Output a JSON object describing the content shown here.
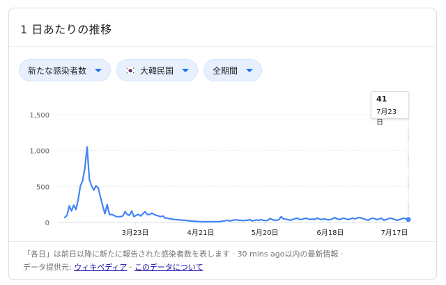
{
  "card": {
    "title": "1 日あたりの推移"
  },
  "filters": {
    "metric": "新たな感染者数",
    "country": "大韓民国",
    "range": "全期間"
  },
  "tooltip": {
    "value": "41",
    "date": "7月23日"
  },
  "footer": {
    "line1_note": "「各日」は前日以降に新たに報告された感染者数を表します",
    "line1_sep": " · ",
    "line1_update": "30 mins ago以内の最新情報",
    "line1_end": " ·",
    "source_label": "データ提供元: ",
    "source_link": "ウィキペディア",
    "about_sep": " · ",
    "about_link": "このデータについて"
  },
  "colors": {
    "line": "#4285f4",
    "grid": "#dadce0",
    "chip_bg": "#e8f0fe"
  },
  "chart_data": {
    "type": "line",
    "ylim": [
      0,
      1500
    ],
    "yticks": [
      0,
      500,
      1000,
      1500
    ],
    "ytick_labels": [
      "0",
      "500",
      "1,000",
      "1,500"
    ],
    "xtick_labels": [
      "3月23日",
      "4月21日",
      "5月20日",
      "6月18日",
      "7月17日"
    ],
    "grid": true,
    "series": [
      {
        "values": [
          70,
          100,
          230,
          160,
          240,
          180,
          320,
          510,
          580,
          760,
          1050,
          600,
          510,
          450,
          510,
          480,
          350,
          230,
          120,
          250,
          110,
          110,
          100,
          80,
          80,
          80,
          90,
          150,
          110,
          100,
          160,
          80,
          100,
          110,
          90,
          120,
          150,
          110,
          110,
          130,
          110,
          100,
          90,
          80,
          90,
          60,
          60,
          50,
          50,
          40,
          40,
          35,
          35,
          30,
          30,
          25,
          20,
          20,
          15,
          15,
          12,
          12,
          10,
          10,
          10,
          10,
          12,
          10,
          12,
          10,
          15,
          20,
          25,
          30,
          20,
          30,
          35,
          35,
          30,
          30,
          25,
          30,
          30,
          40,
          20,
          30,
          35,
          30,
          40,
          30,
          25,
          30,
          55,
          40,
          30,
          30,
          40,
          80,
          50,
          45,
          40,
          30,
          40,
          50,
          60,
          45,
          40,
          50,
          60,
          50,
          40,
          50,
          40,
          60,
          50,
          40,
          50,
          45,
          35,
          40,
          50,
          70,
          50,
          40,
          50,
          60,
          50,
          40,
          50,
          60,
          50,
          60,
          70,
          60,
          50,
          40,
          30,
          50,
          60,
          50,
          40,
          50,
          60,
          30,
          40,
          50,
          60,
          50,
          40,
          30,
          40,
          50,
          60,
          50,
          41
        ]
      }
    ]
  }
}
